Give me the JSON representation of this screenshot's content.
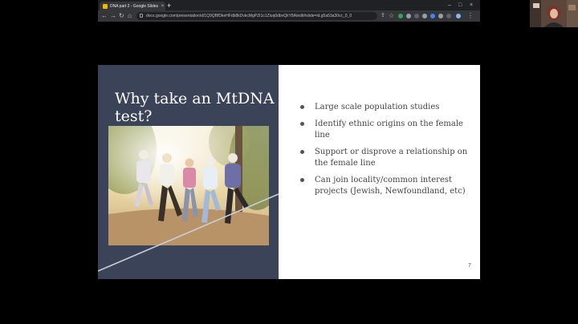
{
  "browser": {
    "tab_title": "DNA part 2 - Google Slides",
    "tab_close": "×",
    "new_tab": "+",
    "window_controls": [
      "–",
      "□",
      "×"
    ],
    "nav": {
      "back": "←",
      "forward": "→",
      "reload": "↻",
      "home": "⌂"
    },
    "url": "docs.google.com/presentation/d/1Q9QBfDkeHFdb8kDvkcMgPZt1c1Zluq0dbvQkY8A/edit#slide=id.g5a53a30cc_0_0",
    "star": "☆"
  },
  "slide": {
    "title": "Why take an MtDNA test?",
    "bullets": [
      "Large scale population studies",
      "Identify ethnic origins on the female line",
      "Support or disprove a relationship on the female line",
      "Can join locality/common interest projects (Jewish, Newfoundland, etc)"
    ],
    "page_number": "7"
  },
  "colors": {
    "panel": "#3a4358",
    "accent_line": "#c9ced8"
  }
}
